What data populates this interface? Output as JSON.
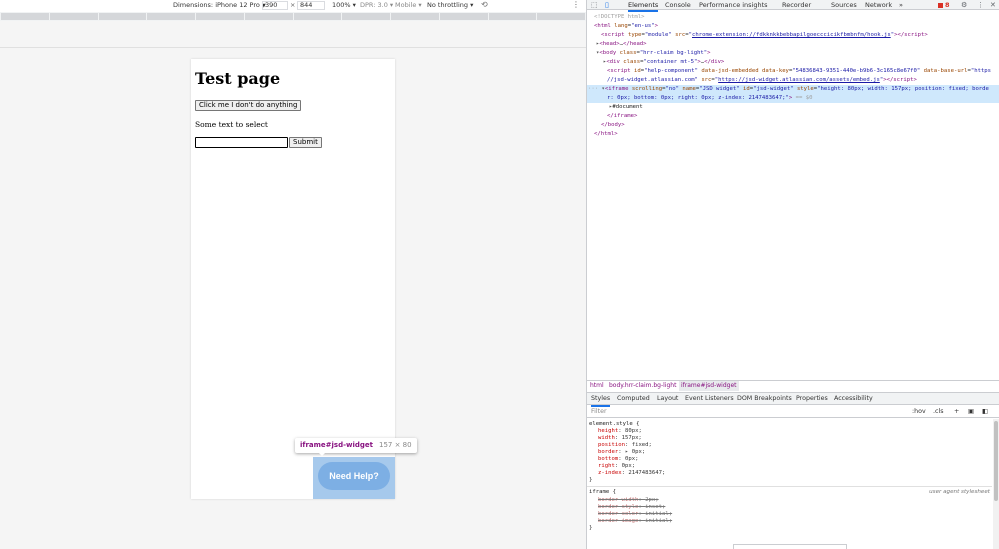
{
  "device_toolbar": {
    "dimensions_label": "Dimensions: iPhone 12 Pro",
    "width": "390",
    "times": "×",
    "height": "844",
    "zoom": "100%",
    "dpr": "DPR: 3.0",
    "mode": "Mobile",
    "throttling": "No throttling"
  },
  "page": {
    "title": "Test page",
    "button_label": "Click me I don't do anything",
    "select_text": "Some text to select",
    "input_value": "",
    "submit_label": "Submit",
    "widget_label": "Need Help?"
  },
  "inspect_tooltip": {
    "selector": "iframe#jsd-widget",
    "size": "157 × 80"
  },
  "devtools": {
    "tabs": [
      "Elements",
      "Console",
      "Performance insights",
      "Recorder",
      "Sources",
      "Network"
    ],
    "overflow": "»",
    "error_count": "8",
    "dom": {
      "l1": "<!DOCTYPE html>",
      "l2_lang": "\"en-us\"",
      "l3_src": "chrome-extension://fdkknkkbebbapilgoecccicikfbmbnfm/hook.js",
      "l5_class": "\"hrr-claim bg-light\"",
      "l6_class": "\"container mt-5\"",
      "l7_key": "\"54836843-9351-440e-b9b6-3c165c8e67f0\"",
      "l7_base": "\"https",
      "l8_base_cont": "//jsd-widget.atlassian.com\"",
      "l8_src": "https://jsd-widget.atlassian.com/assets/embed.js",
      "l9_style": "\"height: 80px; width: 157px; position: fixed; borde",
      "l10_cont": "r: 0px; bottom: 0px; right: 0px; z-index: 2147483647;\"",
      "l10_eq": "== $0",
      "l11": "#document"
    },
    "breadcrumbs": [
      "html",
      "body.hrr-claim.bg-light",
      "iframe#jsd-widget"
    ],
    "subtabs": [
      "Styles",
      "Computed",
      "Layout",
      "Event Listeners",
      "DOM Breakpoints",
      "Properties",
      "Accessibility"
    ],
    "filter_placeholder": "Filter",
    "filter_tools": [
      ":hov",
      ".cls",
      "+"
    ],
    "element_style": {
      "selector": "element.style {",
      "props": [
        [
          "height",
          "80px;"
        ],
        [
          "width",
          "157px;"
        ],
        [
          "position",
          "fixed;"
        ],
        [
          "border",
          "0px;"
        ],
        [
          "bottom",
          "0px;"
        ],
        [
          "right",
          "0px;"
        ],
        [
          "z-index",
          "2147483647;"
        ]
      ]
    },
    "iframe_rule": {
      "selector": "iframe {",
      "source": "user agent stylesheet",
      "props": [
        [
          "border-width",
          "2px;"
        ],
        [
          "border-style",
          "inset;"
        ],
        [
          "border-color",
          "initial;"
        ],
        [
          "border-image",
          "initial;"
        ]
      ]
    }
  }
}
